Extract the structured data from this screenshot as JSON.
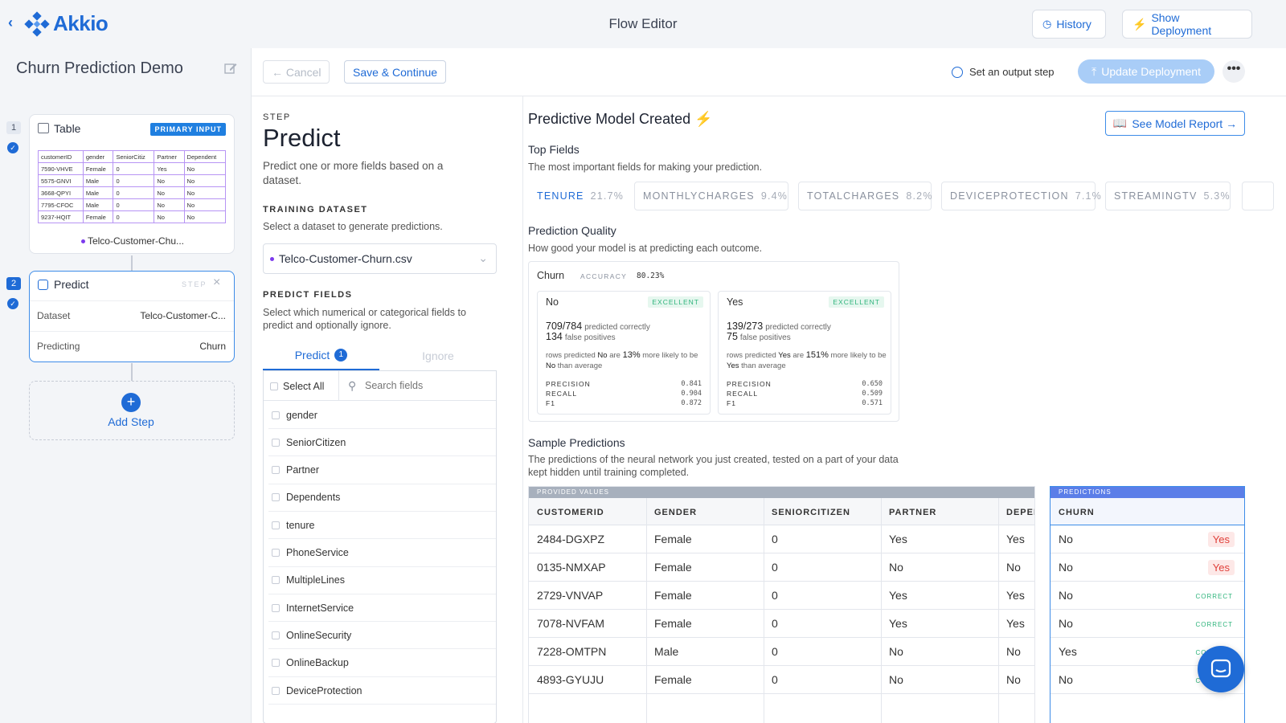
{
  "header": {
    "logo_text": "Akkio",
    "title": "Flow Editor",
    "history_label": "History",
    "deployment_label": "Show Deployment"
  },
  "project": {
    "title": "Churn Prediction Demo"
  },
  "flow": {
    "step1": {
      "number": "1",
      "title": "Table",
      "badge": "PRIMARY INPUT",
      "dataset": "Telco-Customer-Chu...",
      "mini_headers": [
        "customerID",
        "gender",
        "SeniorCitiz",
        "Partner",
        "Dependent"
      ],
      "mini_rows": [
        [
          "7590-VHVE",
          "Female",
          "0",
          "Yes",
          "No"
        ],
        [
          "5575-GNVI",
          "Male",
          "0",
          "No",
          "No"
        ],
        [
          "3668-QPYI",
          "Male",
          "0",
          "No",
          "No"
        ],
        [
          "7795-CFOC",
          "Male",
          "0",
          "No",
          "No"
        ],
        [
          "9237-HQIT",
          "Female",
          "0",
          "No",
          "No"
        ]
      ]
    },
    "step2": {
      "number": "2",
      "title": "Predict",
      "tag": "STEP",
      "dataset_label": "Dataset",
      "dataset_value": "Telco-Customer-C...",
      "predicting_label": "Predicting",
      "predicting_value": "Churn"
    },
    "add_step": "Add Step"
  },
  "toolbar": {
    "cancel": "← Cancel",
    "save": "Save & Continue",
    "output_step": "Set an output step",
    "update": "Update Deployment"
  },
  "step_panel": {
    "eyebrow": "STEP",
    "title": "Predict",
    "description": "Predict one or more fields based on a dataset.",
    "training_label": "TRAINING DATASET",
    "training_desc": "Select a dataset to generate predictions.",
    "dataset": "Telco-Customer-Churn.csv",
    "predict_label": "PREDICT FIELDS",
    "predict_desc": "Select which numerical or categorical fields to predict and optionally ignore.",
    "tab_predict": "Predict",
    "tab_predict_count": "1",
    "tab_ignore": "Ignore",
    "select_all": "Select All",
    "search_placeholder": "Search fields",
    "fields": [
      "gender",
      "SeniorCitizen",
      "Partner",
      "Dependents",
      "tenure",
      "PhoneService",
      "MultipleLines",
      "InternetService",
      "OnlineSecurity",
      "OnlineBackup",
      "DeviceProtection"
    ]
  },
  "results": {
    "title": "Predictive Model Created",
    "report_btn": "See Model Report →",
    "top_fields_title": "Top Fields",
    "top_fields_desc": "The most important fields for making your prediction.",
    "top_fields": [
      {
        "name": "TENURE",
        "pct": "21.7%"
      },
      {
        "name": "MONTHLYCHARGES",
        "pct": "9.4%"
      },
      {
        "name": "TOTALCHARGES",
        "pct": "8.2%"
      },
      {
        "name": "DEVICEPROTECTION",
        "pct": "7.1%"
      },
      {
        "name": "STREAMINGTV",
        "pct": "5.3%"
      }
    ],
    "quality_title": "Prediction Quality",
    "quality_desc": "How good your model is at predicting each outcome.",
    "churn_label": "Churn",
    "accuracy_label": "ACCURACY",
    "accuracy_value": "80.23%",
    "outcomes": [
      {
        "name": "No",
        "badge": "EXCELLENT",
        "fraction": "709/784",
        "correct_text": "predicted correctly",
        "fp": "134",
        "fp_text": "false positives",
        "lift_pre": "rows predicted",
        "lift_val": "No",
        "lift_mid": "are",
        "lift_pct": "13%",
        "lift_post": "more likely to be",
        "lift_val2": "No",
        "lift_end": "than average",
        "precision": "0.841",
        "recall": "0.904",
        "f1": "0.872"
      },
      {
        "name": "Yes",
        "badge": "EXCELLENT",
        "fraction": "139/273",
        "correct_text": "predicted correctly",
        "fp": "75",
        "fp_text": "false positives",
        "lift_pre": "rows predicted",
        "lift_val": "Yes",
        "lift_mid": "are",
        "lift_pct": "151%",
        "lift_post": "more likely to be",
        "lift_val2": "Yes",
        "lift_end": "than average",
        "precision": "0.650",
        "recall": "0.509",
        "f1": "0.571"
      }
    ],
    "metric_labels": {
      "precision": "PRECISION",
      "recall": "RECALL",
      "f1": "F1"
    },
    "sample_title": "Sample Predictions",
    "sample_desc": "The predictions of the neural network you just created, tested on a part of your data kept hidden until training completed.",
    "provided_label": "PROVIDED VALUES",
    "predictions_label": "PREDICTIONS",
    "columns": [
      "CUSTOMERID",
      "GENDER",
      "SENIORCITIZEN",
      "PARTNER",
      "DEPEN"
    ],
    "pred_column": "CHURN",
    "rows": [
      {
        "id": "2484-DGXPZ",
        "gender": "Female",
        "senior": "0",
        "partner": "Yes",
        "dep": "Yes",
        "pred": "No",
        "actual": "Yes"
      },
      {
        "id": "0135-NMXAP",
        "gender": "Female",
        "senior": "0",
        "partner": "No",
        "dep": "No",
        "pred": "No",
        "actual": "Yes"
      },
      {
        "id": "2729-VNVAP",
        "gender": "Female",
        "senior": "0",
        "partner": "Yes",
        "dep": "Yes",
        "pred": "No",
        "actual": "CORRECT"
      },
      {
        "id": "7078-NVFAM",
        "gender": "Female",
        "senior": "0",
        "partner": "Yes",
        "dep": "Yes",
        "pred": "No",
        "actual": "CORRECT"
      },
      {
        "id": "7228-OMTPN",
        "gender": "Male",
        "senior": "0",
        "partner": "No",
        "dep": "No",
        "pred": "Yes",
        "actual": "CORRECT"
      },
      {
        "id": "4893-GYUJU",
        "gender": "Female",
        "senior": "0",
        "partner": "No",
        "dep": "No",
        "pred": "No",
        "actual": "CORRECT"
      }
    ]
  }
}
